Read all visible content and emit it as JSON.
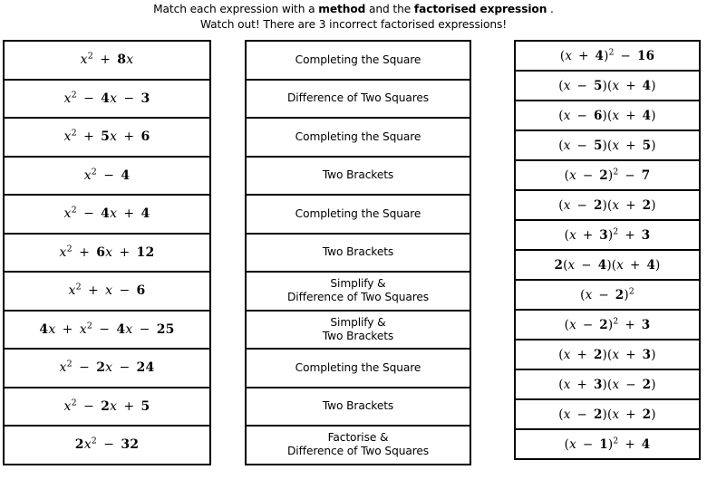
{
  "heading": {
    "line1_part1": "Match each expression with a ",
    "line1_bold1": "method",
    "line1_part2": " and the ",
    "line1_bold2": "factorised expression",
    "line1_part3": " .",
    "line2": "Watch out! There are 3 incorrect factorised expressions!"
  },
  "columns": {
    "expressions": {
      "name": "expressions",
      "cells": [
        "x² + 8x",
        "x² − 4x − 3",
        "x² + 5x + 6",
        "x² − 4",
        "x² − 4x + 4",
        "x² + 6x + 12",
        "x² + x − 6",
        "4x + x² − 4x − 25",
        "x² − 2x − 24",
        "x² − 2x + 5",
        "2x² − 32"
      ]
    },
    "methods": {
      "name": "methods",
      "cells": [
        {
          "line1": "Completing the Square",
          "line2": ""
        },
        {
          "line1": "Difference of Two Squares",
          "line2": ""
        },
        {
          "line1": "Completing the Square",
          "line2": ""
        },
        {
          "line1": "Two Brackets",
          "line2": ""
        },
        {
          "line1": "Completing the Square",
          "line2": ""
        },
        {
          "line1": "Two Brackets",
          "line2": ""
        },
        {
          "line1": "Simplify &",
          "line2": "Difference of Two Squares"
        },
        {
          "line1": "Simplify &",
          "line2": "Two Brackets"
        },
        {
          "line1": "Completing the Square",
          "line2": ""
        },
        {
          "line1": "Two Brackets",
          "line2": ""
        },
        {
          "line1": "Factorise &",
          "line2": "Difference of Two Squares"
        }
      ]
    },
    "factorised": {
      "name": "factorised expressions",
      "cells": [
        "(x + 4)² − 16",
        "(x − 5)(x + 4)",
        "(x − 6)(x + 4)",
        "(x − 5)(x + 5)",
        "(x − 2)² − 7",
        "(x − 2)(x + 2)",
        "(x + 3)² + 3",
        "2(x − 4)(x + 4)",
        "(x − 2)²",
        "(x − 2)² + 3",
        "(x + 2)(x + 3)",
        "(x + 3)(x − 2)",
        "(x − 2)(x + 2)",
        "(x − 1)² + 4"
      ]
    }
  },
  "colors": {
    "background": "#ffffff",
    "border": "#000000",
    "text": "#000000"
  }
}
